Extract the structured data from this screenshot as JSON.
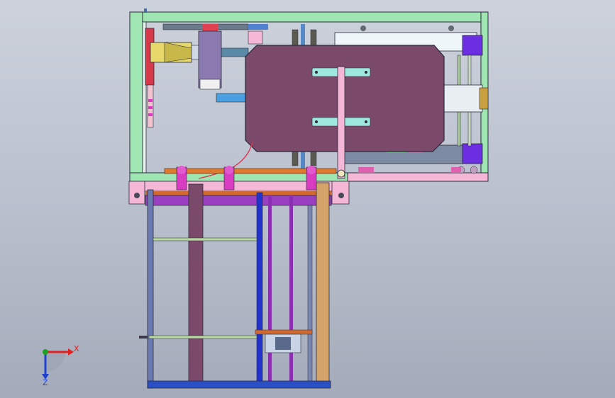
{
  "triad": {
    "x_label": "X",
    "z_label": "Z",
    "x_color": "#e02020",
    "z_color": "#2040d0",
    "y_color": "#20a020"
  },
  "colors": {
    "frame_green": "#9fe6b2",
    "plate_maroon": "#7b4a6a",
    "pink": "#f4b7d6",
    "magenta": "#d83cc0",
    "purple": "#8a2fb0",
    "blue": "#2233cc",
    "tan": "#d4a36a",
    "cyan": "#9fe8e0",
    "violet_block": "#6b2ee0",
    "orange": "#e07a2a",
    "dark": "#2a2a3a"
  }
}
